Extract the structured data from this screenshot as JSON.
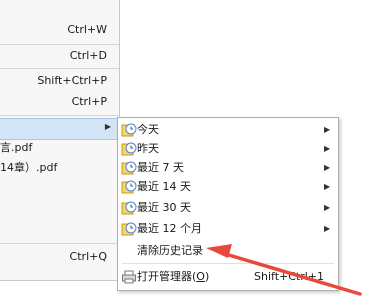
{
  "main_menu": {
    "shortcuts": [
      "Ctrl+W",
      "Ctrl+D",
      "Shift+Ctrl+P",
      "Ctrl+P",
      "Ctrl+Q"
    ],
    "recent_files": [
      "言.pdf",
      "14章）.pdf"
    ]
  },
  "submenu": {
    "items": [
      {
        "label": "今天",
        "icon": "clock-icon"
      },
      {
        "label": "昨天",
        "icon": "clock-icon"
      },
      {
        "label": "最近 7 天",
        "icon": "clock-icon"
      },
      {
        "label": "最近 14 天",
        "icon": "clock-icon"
      },
      {
        "label": "最近 30 天",
        "icon": "clock-icon"
      },
      {
        "label": "最近 12 个月",
        "icon": "clock-icon"
      }
    ],
    "clear_history": "清除历史记录",
    "open_manager": {
      "label": "打开管理器(",
      "mnemonic": "O",
      "suffix": ")",
      "shortcut": "Shift+Ctrl+1",
      "icon": "printer-icon"
    }
  },
  "colors": {
    "highlight": "#d3e4f7",
    "annotation_arrow": "#e8493c"
  }
}
